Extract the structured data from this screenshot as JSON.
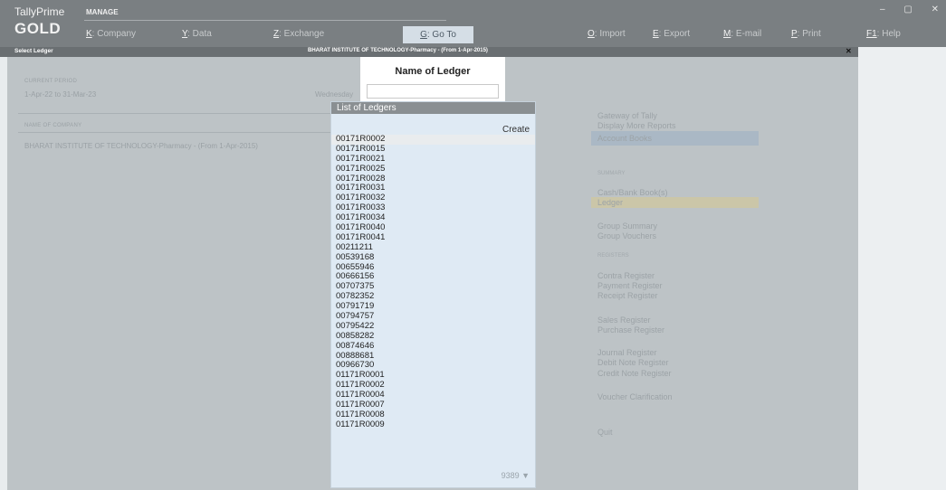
{
  "app": {
    "name": "TallyPrime",
    "edition": "GOLD",
    "section": "MANAGE"
  },
  "menu": [
    {
      "key": "K",
      "label": ": Company"
    },
    {
      "key": "Y",
      "label": ": Data"
    },
    {
      "key": "Z",
      "label": ": Exchange"
    },
    {
      "key": "O",
      "label": ": Import"
    },
    {
      "key": "E",
      "label": ": Export"
    },
    {
      "key": "M",
      "label": ": E-mail"
    },
    {
      "key": "P",
      "label": ": Print"
    },
    {
      "key": "F1",
      "label": ": Help"
    }
  ],
  "goto": {
    "key": "G",
    "label": ": Go To"
  },
  "window_controls": {
    "minimize": "–",
    "maximize": "▢",
    "close": "✕"
  },
  "titlebar": {
    "screen": "Select Ledger",
    "company": "BHARAT INSTITUTE OF TECHNOLOGY-Pharmacy - (From 1-Apr-2015)",
    "close": "✕"
  },
  "background": {
    "current_period_label": "CURRENT PERIOD",
    "current_period": "1-Apr-22 to 31-Mar-23",
    "current_date_label": "Wednesday",
    "company_label": "NAME OF COMPANY",
    "company_name": "BHARAT INSTITUTE OF TECHNOLOGY-Pharmacy - (From 1-Apr-2015)",
    "gateway": [
      {
        "label": "Gateway of Tally",
        "type": "item"
      },
      {
        "label": "Display More Reports",
        "type": "item"
      },
      {
        "label": "Account Books",
        "type": "item"
      },
      {
        "label": "SUMMARY",
        "type": "section"
      },
      {
        "label": "Cash/Bank Book(s)",
        "type": "item"
      },
      {
        "label": "Ledger",
        "type": "item"
      },
      {
        "label": "Group Summary",
        "type": "item"
      },
      {
        "label": "Group Vouchers",
        "type": "item"
      },
      {
        "label": "REGISTERS",
        "type": "section"
      },
      {
        "label": "Contra Register",
        "type": "item"
      },
      {
        "label": "Payment Register",
        "type": "item"
      },
      {
        "label": "Receipt Register",
        "type": "item"
      },
      {
        "label": "Sales Register",
        "type": "item"
      },
      {
        "label": "Purchase Register",
        "type": "item"
      },
      {
        "label": "Journal Register",
        "type": "item"
      },
      {
        "label": "Debit Note Register",
        "type": "item"
      },
      {
        "label": "Credit Note Register",
        "type": "item"
      },
      {
        "label": "Voucher Clarification",
        "type": "item"
      },
      {
        "label": "Quit",
        "type": "item"
      }
    ]
  },
  "name_box": {
    "title": "Name of Ledger",
    "value": ""
  },
  "ledger_list": {
    "title": "List of Ledgers",
    "create_label": "Create",
    "count": "9389 ▼",
    "selected_index": 0,
    "items": [
      "00171R0002",
      "00171R0015",
      "00171R0021",
      "00171R0025",
      "00171R0028",
      "00171R0031",
      "00171R0032",
      "00171R0033",
      "00171R0034",
      "00171R0040",
      "00171R0041",
      "00211211",
      "00539168",
      "00655946",
      "00666156",
      "00707375",
      "00782352",
      "00791719",
      "00794757",
      "00795422",
      "00858282",
      "00874646",
      "00888681",
      "00966730",
      "01171R0001",
      "01171R0002",
      "01171R0004",
      "01171R0007",
      "01171R0008",
      "01171R0009"
    ]
  }
}
